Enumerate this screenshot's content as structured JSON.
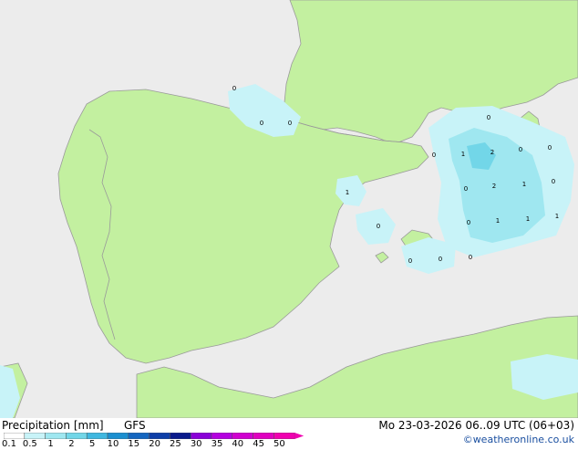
{
  "map": {
    "value_labels": [
      "0",
      "0",
      "0",
      "0",
      "1",
      "2",
      "0",
      "0",
      "1",
      "0",
      "2",
      "1",
      "0",
      "0",
      "1",
      "1",
      "1",
      "0",
      "0",
      "0",
      "0",
      "0"
    ],
    "colors": {
      "sea": "#ececec",
      "land": "#c3f0a0",
      "precip_light": "#c8f3f8",
      "precip_mid": "#9fe7f0",
      "precip_dark": "#72d6e8"
    }
  },
  "footer": {
    "title": "Precipitation [mm]",
    "model": "GFS",
    "datetime": "Mo 23-03-2026 06..09 UTC (06+03)",
    "credit": "©weatheronline.co.uk"
  },
  "legend": {
    "labels": [
      "0.1",
      "0.5",
      "1",
      "2",
      "5",
      "10",
      "15",
      "20",
      "25",
      "30",
      "35",
      "40",
      "45",
      "50"
    ],
    "colors": [
      "#ffffff",
      "#c8f3f8",
      "#9fe7f0",
      "#72d6e8",
      "#3fb7e0",
      "#1b8fd0",
      "#1466c0",
      "#0d3ea8",
      "#0a1a8c",
      "#8a00d8",
      "#b400e0",
      "#d000d0",
      "#e000c0",
      "#f000b0"
    ]
  }
}
